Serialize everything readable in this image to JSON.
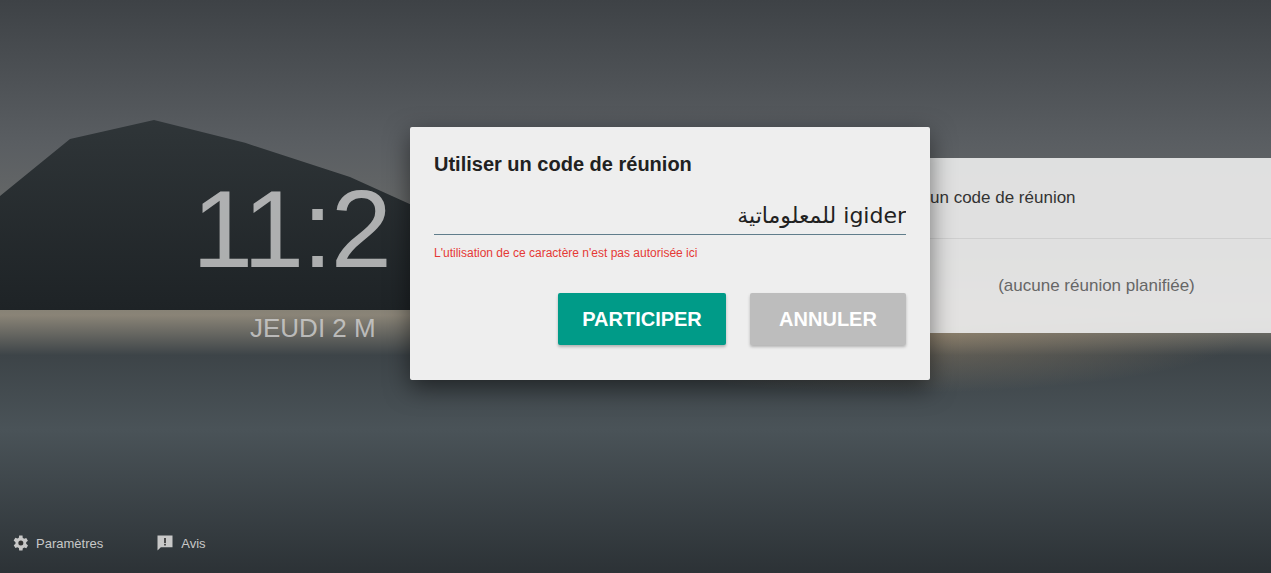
{
  "clock": {
    "time": "11:2",
    "date": "JEUDI 2 M"
  },
  "side_panel": {
    "items": [
      {
        "label": "un code de réunion"
      },
      {
        "label": "(aucune réunion planifiée)"
      }
    ]
  },
  "footer": {
    "items": [
      {
        "label": "Paramètres"
      },
      {
        "label": "Avis"
      }
    ]
  },
  "dialog": {
    "title": "Utiliser un code de réunion",
    "input": {
      "value": "igider للمعلوماتية",
      "invalid": true
    },
    "error": "L'utilisation de ce caractère n'est pas autorisée ici",
    "buttons": [
      {
        "label": "PARTICIPER",
        "primary": true
      },
      {
        "label": "ANNULER",
        "primary": false
      }
    ]
  }
}
